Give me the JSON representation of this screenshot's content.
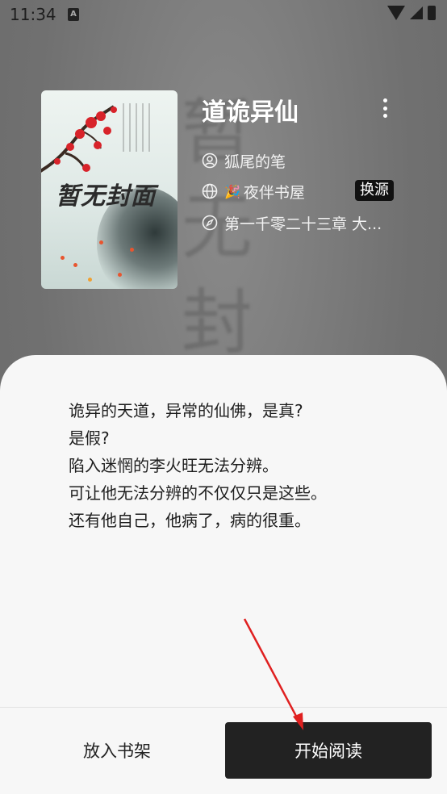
{
  "status_bar": {
    "time": "11:34"
  },
  "background_watermark": [
    "暂",
    "无",
    "封"
  ],
  "book": {
    "title": "道诡异仙",
    "author": "狐尾的笔",
    "source_emoji": "🎉",
    "source": "夜伴书屋",
    "switch_source_label": "换源",
    "latest_chapter": "第一千零二十三章 大..."
  },
  "cover": {
    "placeholder_text": "暂无封面"
  },
  "intro": {
    "lines": [
      "诡异的天道，异常的仙佛，是真?",
      "是假?",
      "陷入迷惘的李火旺无法分辨。",
      "可让他无法分辨的不仅仅只是这些。",
      "还有他自己，他病了，病的很重。"
    ]
  },
  "actions": {
    "add_to_shelf": "放入书架",
    "start_reading": "开始阅读"
  },
  "colors": {
    "sheet_bg": "#f7f7f7",
    "primary_button": "#222222",
    "annotation_arrow": "#e02020"
  },
  "icons": [
    "person-icon",
    "globe-icon",
    "compass-icon",
    "more-vert-icon",
    "wifi-icon",
    "signal-icon",
    "battery-icon"
  ]
}
